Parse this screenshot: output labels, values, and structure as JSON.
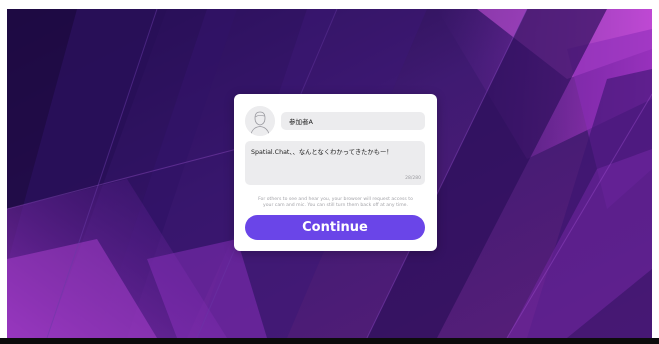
{
  "colors": {
    "background_dark": "#3a1566",
    "background_magenta": "#b83bd0",
    "card": "#ffffff",
    "field": "#ececee",
    "accent_button": "#6a45e8",
    "notice_text": "#a3a3a8"
  },
  "profile": {
    "avatar_icon": "user-avatar-icon",
    "name_value": "参加者A"
  },
  "status": {
    "text": "Spatial.Chat、、なんとなくわかってきたかもー！",
    "char_count": "28/280"
  },
  "notice": {
    "line1": "For others to see and hear you, your browser will request access to",
    "line2": "your cam and mic. You can still turn them back off at any time."
  },
  "actions": {
    "continue_label": "Continue"
  }
}
